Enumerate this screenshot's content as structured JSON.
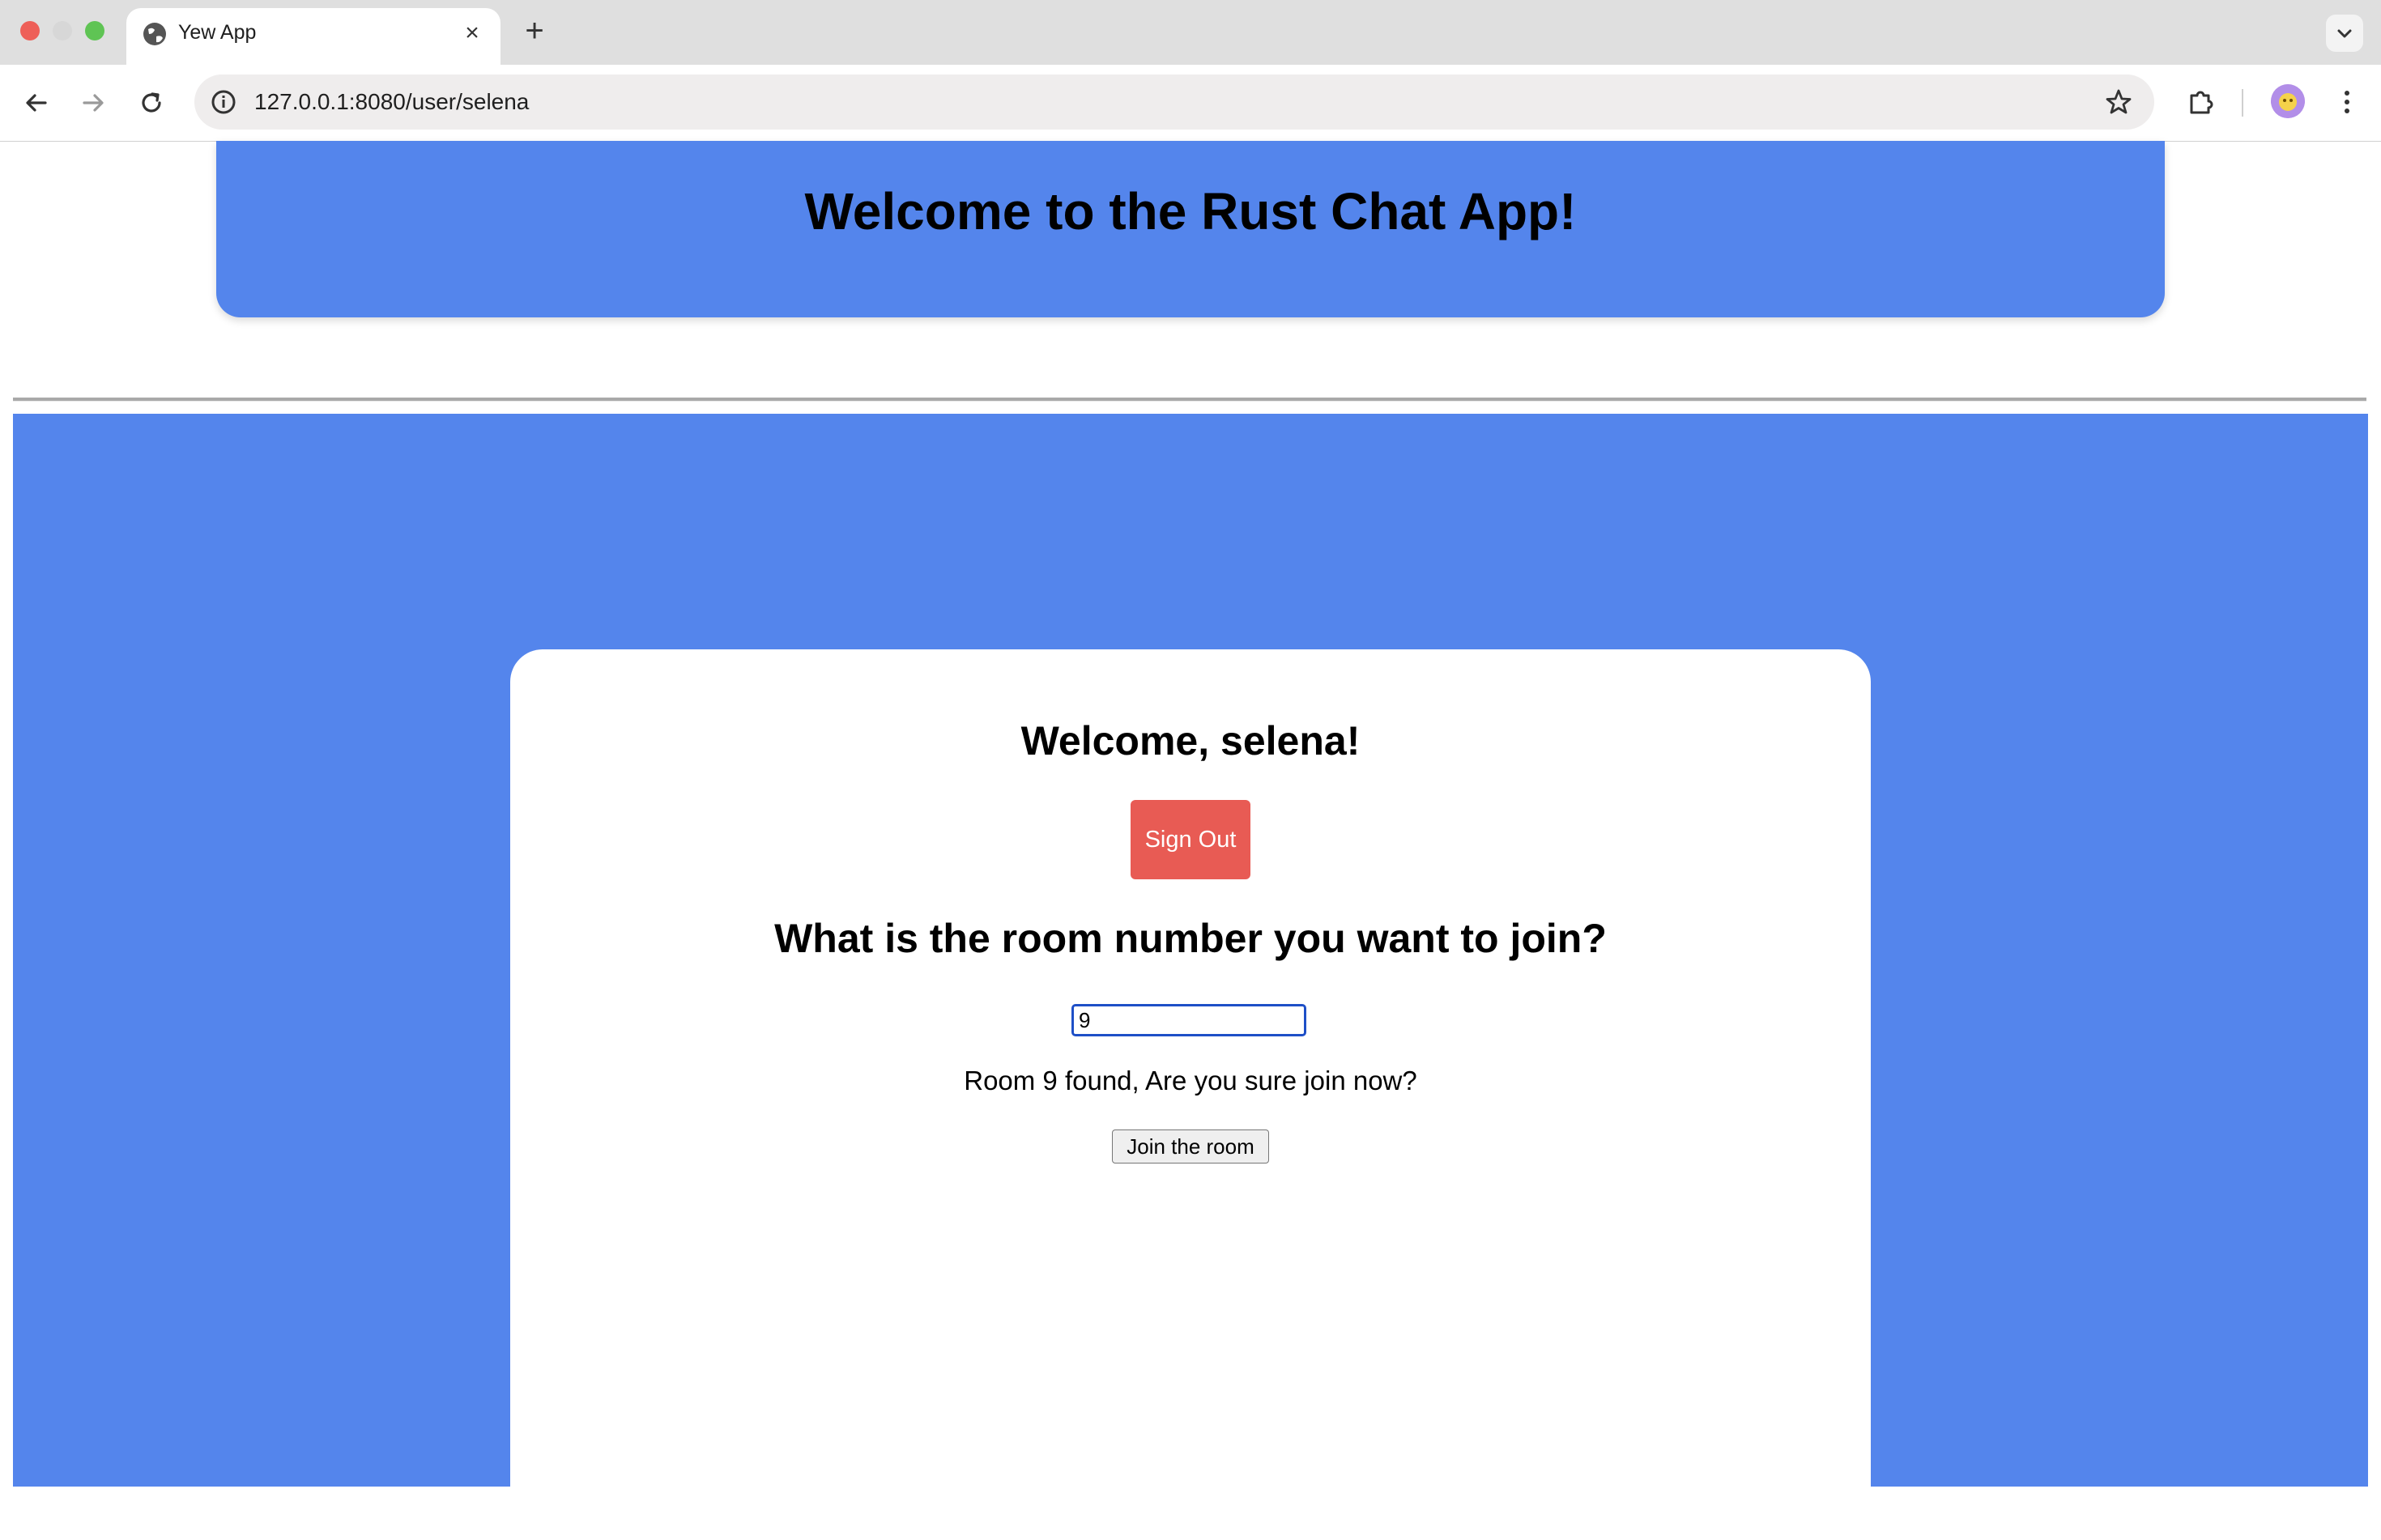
{
  "browser": {
    "tab_title": "Yew App",
    "tab_close": "×",
    "new_tab": "+",
    "url": "127.0.0.1:8080/user/selena"
  },
  "header": {
    "title": "Welcome to the Rust Chat App!"
  },
  "card": {
    "welcome": "Welcome, selena!",
    "signout_label": "Sign Out",
    "question": "What is the room number you want to join?",
    "room_value": "9",
    "found_message": "Room 9 found, Are you sure join now?",
    "join_label": "Join the room"
  },
  "colors": {
    "accent_blue": "#5485ec",
    "signout_red": "#e85b54",
    "input_focus": "#1e4fc7"
  },
  "icons": [
    "globe-icon",
    "close-icon",
    "plus-icon",
    "chevron-down-icon",
    "back-arrow-icon",
    "forward-arrow-icon",
    "reload-icon",
    "info-icon",
    "star-icon",
    "extensions-icon",
    "avatar",
    "menu-icon"
  ]
}
